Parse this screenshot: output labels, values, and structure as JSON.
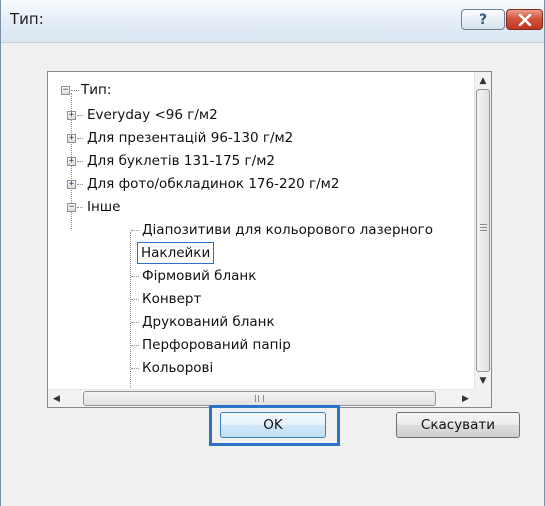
{
  "window": {
    "title": "Тип:",
    "help_glyph": "?",
    "close_icon": "close-icon"
  },
  "tree": {
    "root_label": "Тип:",
    "categories": [
      "Everyday <96 г/м2",
      "Для презентацій 96-130 г/м2",
      "Для буклетів 131-175 г/м2",
      "Для фото/обкладинок 176-220 г/м2"
    ],
    "other_label": "Інше",
    "other_children": [
      "Діапозитиви для кольорового лазерного",
      "Наклейки",
      "Фірмовий бланк",
      "Конверт",
      "Друкований бланк",
      "Перфорований папір",
      "Кольорові"
    ],
    "selected_item": "Наклейки",
    "expand_glyph": "+",
    "collapse_glyph": "−"
  },
  "scrollbars": {
    "vertical_up": "▲",
    "vertical_down": "▼",
    "horizontal_left": "◀",
    "horizontal_right": "▶"
  },
  "buttons": {
    "ok_label": "OK",
    "cancel_label": "Скасувати"
  },
  "colors": {
    "selection_border": "#2a73c8",
    "close_button": "#c0371f"
  }
}
